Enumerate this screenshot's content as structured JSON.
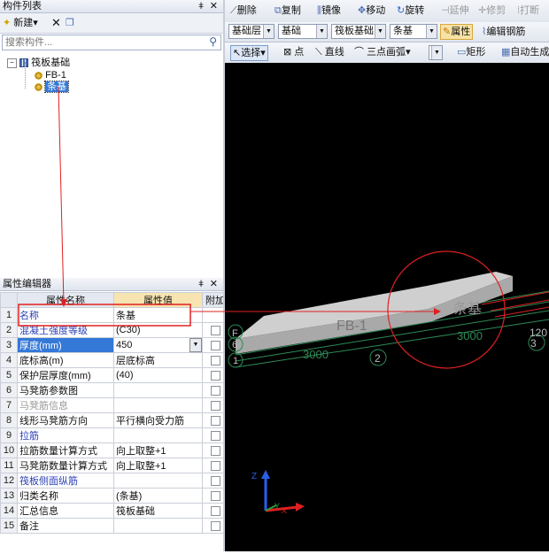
{
  "component_list": {
    "title": "构件列表",
    "pin": "ǂ",
    "close": "✕",
    "new_label": "新建",
    "search_placeholder": "搜索构件...",
    "tree": {
      "root": "筏板基础",
      "children": [
        "FB-1",
        "条基"
      ]
    }
  },
  "property_editor": {
    "title": "属性编辑器",
    "headers": {
      "name": "属性名称",
      "value": "属性值",
      "extra": "附加"
    },
    "rows": [
      {
        "num": "1",
        "name": "名称",
        "value": "条基",
        "style": "blue",
        "check": false
      },
      {
        "num": "2",
        "name": "混凝土强度等级",
        "value": "(C30)",
        "style": "blue",
        "check": true
      },
      {
        "num": "3",
        "name": "厚度(mm)",
        "value": "450",
        "style": "selected",
        "check": true
      },
      {
        "num": "4",
        "name": "底标高(m)",
        "value": "层底标高",
        "style": "normal",
        "check": true
      },
      {
        "num": "5",
        "name": "保护层厚度(mm)",
        "value": "(40)",
        "style": "normal",
        "check": true
      },
      {
        "num": "6",
        "name": "马凳筋参数图",
        "value": "",
        "style": "normal",
        "check": true
      },
      {
        "num": "7",
        "name": "马凳筋信息",
        "value": "",
        "style": "gray",
        "check": true
      },
      {
        "num": "8",
        "name": "线形马凳筋方向",
        "value": "平行横向受力筋",
        "style": "normal",
        "check": true
      },
      {
        "num": "9",
        "name": "拉筋",
        "value": "",
        "style": "blue",
        "check": true
      },
      {
        "num": "10",
        "name": "拉筋数量计算方式",
        "value": "向上取整+1",
        "style": "normal",
        "check": true
      },
      {
        "num": "11",
        "name": "马凳筋数量计算方式",
        "value": "向上取整+1",
        "style": "normal",
        "check": true
      },
      {
        "num": "12",
        "name": "筏板侧面纵筋",
        "value": "",
        "style": "blue",
        "check": true
      },
      {
        "num": "13",
        "name": "归类名称",
        "value": "(条基)",
        "style": "normal",
        "check": true
      },
      {
        "num": "14",
        "name": "汇总信息",
        "value": "筏板基础",
        "style": "normal",
        "check": true
      },
      {
        "num": "15",
        "name": "备注",
        "value": "",
        "style": "normal",
        "check": true
      }
    ]
  },
  "toolbar1": {
    "delete": "删除",
    "copy": "复制",
    "mirror": "镜像",
    "move": "移动",
    "rotate": "旋转",
    "extend": "延伸",
    "trim": "修剪",
    "print": "打断"
  },
  "toolbar2": {
    "floor": "基础层",
    "category": "基础",
    "type": "筏板基础",
    "component": "条基",
    "properties": "属性",
    "edit_rebar": "编辑钢筋"
  },
  "toolbar3": {
    "select": "选择",
    "point": "点",
    "line": "直线",
    "arc": "三点画弧",
    "rect": "矩形",
    "auto": "自动生成"
  },
  "viewport": {
    "label_fb1": "FB-1",
    "label_strip": "条基",
    "dim_left": "3000",
    "dim_right": "3000",
    "axis_2": "2",
    "axis_3": "3",
    "axis_label_right": "120",
    "axis_F": "F",
    "axis_6": "6",
    "axis_1": "1",
    "axis_z": "Z",
    "axis_y": "Y",
    "axis_x": "X",
    "colors": {
      "background": "#000000",
      "slab": "#c7c7c7",
      "highlight": "#e02020",
      "grid": "#2e8b57"
    }
  }
}
